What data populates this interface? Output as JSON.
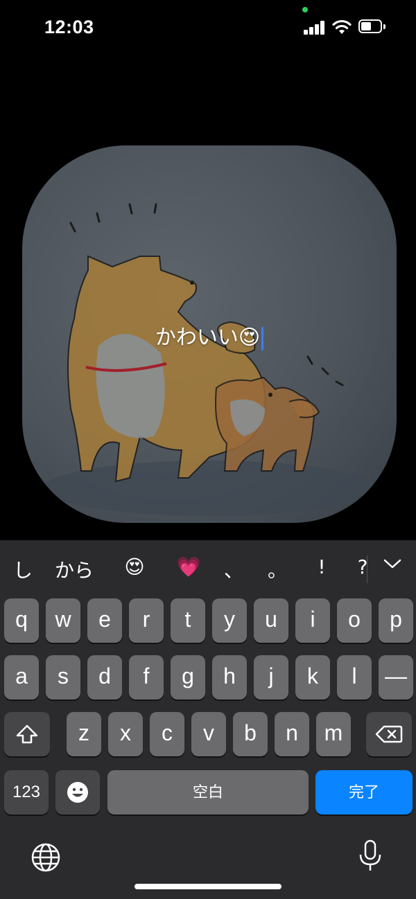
{
  "status": {
    "time": "12:03"
  },
  "photo": {
    "caption": "かわいい😍"
  },
  "suggestions": [
    "し",
    "から",
    "😍",
    "💗",
    "、",
    "。",
    "!",
    "?"
  ],
  "keyboard": {
    "row1": [
      "q",
      "w",
      "e",
      "r",
      "t",
      "y",
      "u",
      "i",
      "o",
      "p"
    ],
    "row2": [
      "a",
      "s",
      "d",
      "f",
      "g",
      "h",
      "j",
      "k",
      "l",
      "—"
    ],
    "row3": [
      "z",
      "x",
      "c",
      "v",
      "b",
      "n",
      "m"
    ],
    "num_label": "123",
    "space_label": "空白",
    "done_label": "完了"
  },
  "colors": {
    "accent": "#0a84ff",
    "key": "#6b6b6d",
    "key_dark": "#464648"
  },
  "icons": [
    "signal-icon",
    "wifi-icon",
    "battery-icon",
    "shift-icon",
    "delete-icon",
    "emoji-icon",
    "globe-icon",
    "mic-icon",
    "chevron-down-icon"
  ]
}
